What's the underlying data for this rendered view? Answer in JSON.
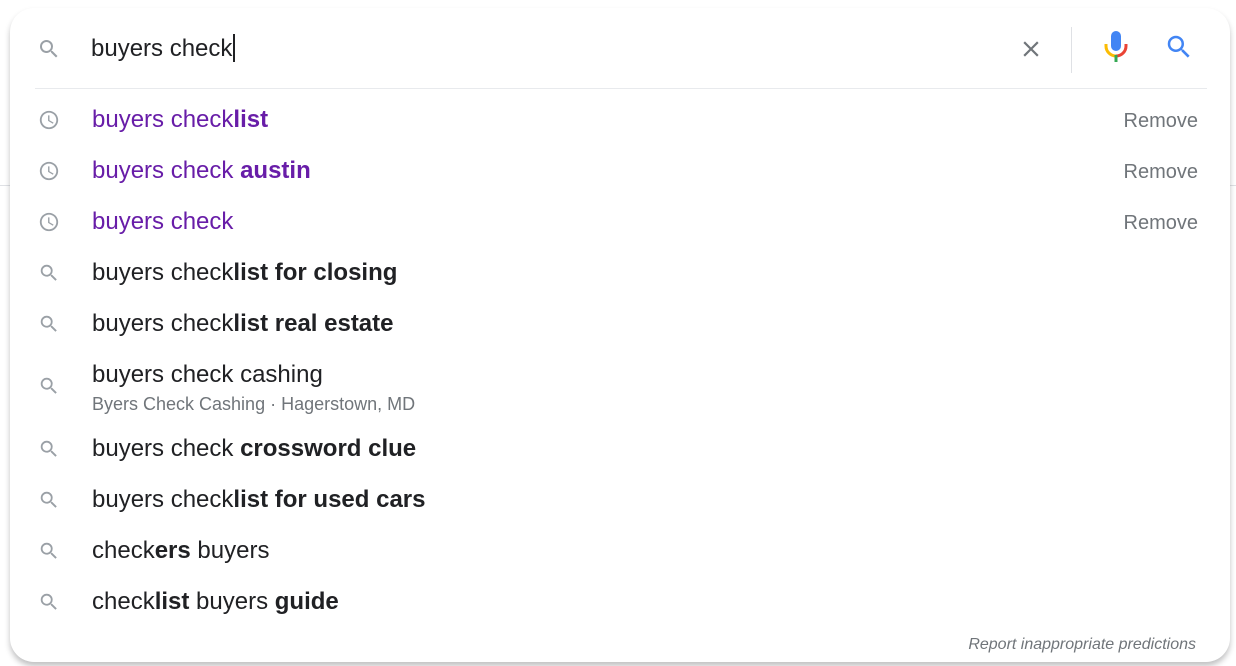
{
  "search": {
    "query": "buyers check"
  },
  "colors": {
    "visited": "#681da8",
    "text": "#202124",
    "muted": "#70757a",
    "search_blue": "#4285f4",
    "mic_red": "#ea4335",
    "mic_yellow": "#fbbc04",
    "mic_green": "#34a853"
  },
  "suggestions": [
    {
      "type": "history",
      "icon": "history-icon",
      "parts": [
        {
          "t": "buyers check",
          "b": false
        },
        {
          "t": "list",
          "b": true
        }
      ],
      "remove": "Remove"
    },
    {
      "type": "history",
      "icon": "history-icon",
      "parts": [
        {
          "t": "buyers check ",
          "b": false
        },
        {
          "t": "austin",
          "b": true
        }
      ],
      "remove": "Remove"
    },
    {
      "type": "history",
      "icon": "history-icon",
      "parts": [
        {
          "t": "buyers check",
          "b": false
        }
      ],
      "remove": "Remove"
    },
    {
      "type": "search",
      "icon": "search-icon",
      "parts": [
        {
          "t": "buyers check",
          "b": false
        },
        {
          "t": "list for closing",
          "b": true
        }
      ]
    },
    {
      "type": "search",
      "icon": "search-icon",
      "parts": [
        {
          "t": "buyers check",
          "b": false
        },
        {
          "t": "list real estate",
          "b": true
        }
      ]
    },
    {
      "type": "search",
      "icon": "search-icon",
      "parts": [
        {
          "t": "buyers check cashing",
          "b": false
        }
      ],
      "subtitle": "Byers Check Cashing · Hagerstown, MD"
    },
    {
      "type": "search",
      "icon": "search-icon",
      "parts": [
        {
          "t": "buyers check ",
          "b": false
        },
        {
          "t": "crossword clue",
          "b": true
        }
      ]
    },
    {
      "type": "search",
      "icon": "search-icon",
      "parts": [
        {
          "t": "buyers check",
          "b": false
        },
        {
          "t": "list for used cars",
          "b": true
        }
      ]
    },
    {
      "type": "search",
      "icon": "search-icon",
      "parts": [
        {
          "t": "check",
          "b": false
        },
        {
          "t": "ers",
          "b": true
        },
        {
          "t": " buyers",
          "b": false
        }
      ]
    },
    {
      "type": "search",
      "icon": "search-icon",
      "parts": [
        {
          "t": "check",
          "b": false
        },
        {
          "t": "list",
          "b": true
        },
        {
          "t": " buyers ",
          "b": false
        },
        {
          "t": "guide",
          "b": true
        }
      ]
    }
  ],
  "footer": {
    "report_label": "Report inappropriate predictions"
  }
}
